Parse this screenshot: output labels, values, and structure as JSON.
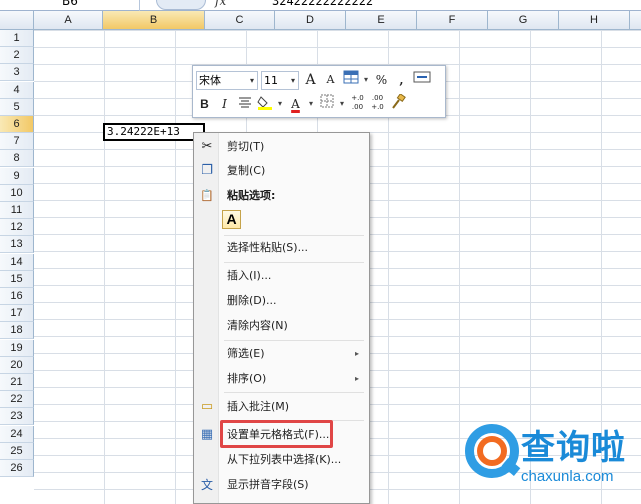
{
  "formula_bar": {
    "name_box": "B6",
    "fx_label": "fx",
    "value": "32422222222222"
  },
  "columns": [
    "A",
    "B",
    "C",
    "D",
    "E",
    "F",
    "G",
    "H"
  ],
  "rows": [
    "1",
    "2",
    "3",
    "4",
    "5",
    "6",
    "7",
    "8",
    "9",
    "10",
    "11",
    "12",
    "13",
    "14",
    "15",
    "16",
    "17",
    "18",
    "19",
    "20",
    "21",
    "22",
    "23",
    "24",
    "25",
    "26"
  ],
  "active_cell": {
    "column": "B",
    "row": "6",
    "display": "3.24222E+13"
  },
  "mini_toolbar": {
    "font_name": "宋体",
    "font_size": "11",
    "grow_font": "A",
    "shrink_font": "A",
    "percent": "%",
    "comma": ",",
    "bold": "B",
    "italic": "I",
    "font_color": "A",
    "inc_decimal": "+.0\n.00",
    "dec_decimal": ".00\n+.0",
    "dropdown_arrow": "▾"
  },
  "context_menu": {
    "items": [
      {
        "label": "剪切(T)",
        "icon": "scissors-icon",
        "glyph": "✂"
      },
      {
        "label": "复制(C)",
        "icon": "copy-icon",
        "glyph": "❐"
      },
      {
        "label": "粘贴选项:",
        "icon": "paste-icon",
        "glyph": "📋"
      },
      {
        "label": "选择性粘贴(S)...",
        "icon": "",
        "glyph": ""
      },
      {
        "label": "插入(I)...",
        "icon": "",
        "glyph": ""
      },
      {
        "label": "删除(D)...",
        "icon": "",
        "glyph": ""
      },
      {
        "label": "清除内容(N)",
        "icon": "",
        "glyph": ""
      },
      {
        "label": "筛选(E)",
        "icon": "",
        "glyph": "",
        "submenu": "▸"
      },
      {
        "label": "排序(O)",
        "icon": "",
        "glyph": "",
        "submenu": "▸"
      },
      {
        "label": "插入批注(M)",
        "icon": "comment-icon",
        "glyph": "▭"
      },
      {
        "label": "设置单元格格式(F)...",
        "icon": "format-cells-icon",
        "glyph": "▦"
      },
      {
        "label": "从下拉列表中选择(K)...",
        "icon": "",
        "glyph": ""
      },
      {
        "label": "显示拼音字段(S)",
        "icon": "phonetic-icon",
        "glyph": "文"
      }
    ],
    "paste_option_glyph": "A"
  },
  "watermark": {
    "brand": "查询啦",
    "domain": "chaxunla.com"
  },
  "colors": {
    "highlight_border": "#e04646",
    "header_selected": "#f2c866",
    "brand_blue": "#1a8ad8",
    "brand_orange": "#f26b21"
  }
}
